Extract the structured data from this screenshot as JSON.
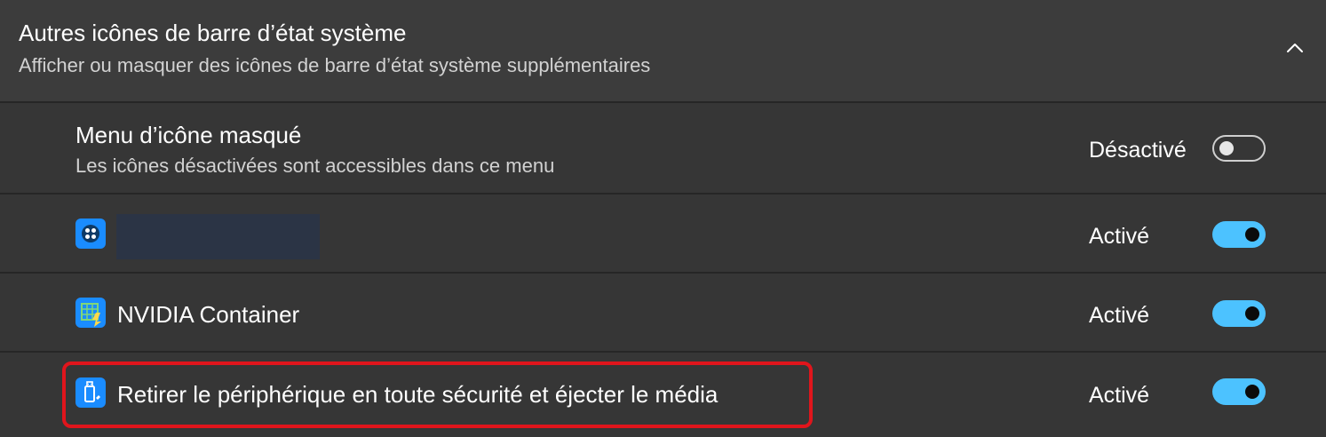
{
  "section": {
    "title": "Autres icônes de barre d’état système",
    "subtitle": "Afficher ou masquer des icônes de barre d’état système supplémentaires",
    "chevron_icon": "chevron-up-icon"
  },
  "rows": [
    {
      "title": "Menu d’icône masqué",
      "subtitle": "Les icônes désactivées sont accessibles dans ce menu",
      "state_label": "Désactivé",
      "toggle_on": false
    },
    {
      "icon": "app-blue-icon",
      "title": "",
      "state_label": "Activé",
      "toggle_on": true
    },
    {
      "icon": "nvidia-container-icon",
      "title": "NVIDIA Container",
      "state_label": "Activé",
      "toggle_on": true
    },
    {
      "icon": "usb-eject-icon",
      "title": "Retirer le périphérique en toute sécurité et éjecter le média",
      "state_label": "Activé",
      "toggle_on": true
    }
  ],
  "colors": {
    "accent": "#4cc2ff",
    "highlight": "#e0151c",
    "icon_blue": "#1a8cff"
  }
}
